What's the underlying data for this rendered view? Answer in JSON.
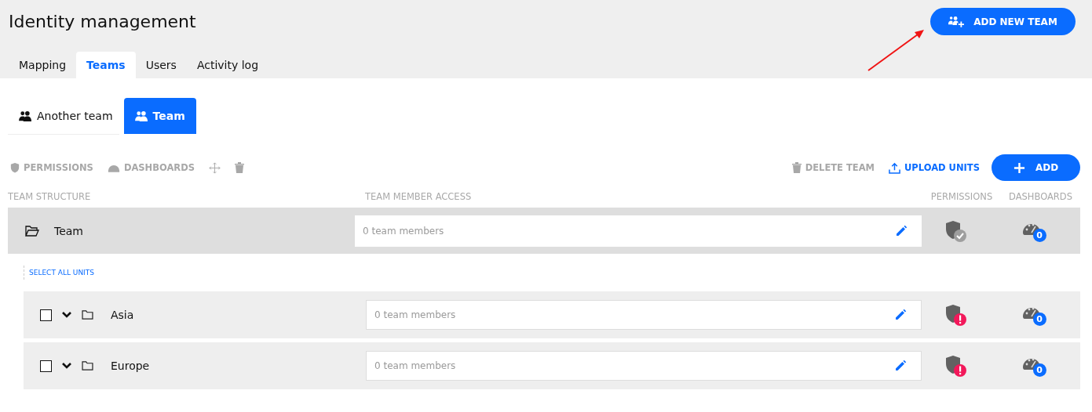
{
  "page": {
    "title": "Identity management"
  },
  "header_button": {
    "label": "ADD NEW TEAM"
  },
  "tabs": [
    {
      "label": "Mapping",
      "selected": false
    },
    {
      "label": "Teams",
      "selected": true
    },
    {
      "label": "Users",
      "selected": false
    },
    {
      "label": "Activity log",
      "selected": false
    }
  ],
  "team_tabs": [
    {
      "label": "Another team",
      "selected": false
    },
    {
      "label": "Team",
      "selected": true
    }
  ],
  "toolbar": {
    "left_actions": [
      {
        "kind": "permissions",
        "label": "PERMISSIONS",
        "disabled": true
      },
      {
        "kind": "dashboards",
        "label": "DASHBOARDS",
        "disabled": true
      },
      {
        "kind": "move",
        "disabled": true
      },
      {
        "kind": "delete",
        "disabled": true
      }
    ],
    "right_actions": [
      {
        "kind": "delete",
        "label": "DELETE TEAM",
        "disabled": true
      },
      {
        "kind": "upload",
        "label": "UPLOAD UNITS",
        "disabled": false
      }
    ],
    "add_button": {
      "label": "ADD"
    }
  },
  "columns": [
    "TEAM STRUCTURE",
    "TEAM MEMBER ACCESS",
    "PERMISSIONS",
    "DASHBOARDS"
  ],
  "root": {
    "name": "Team",
    "members": "0 team members",
    "permissions_ok": true,
    "dashboards_count": "0"
  },
  "select_all": "SELECT ALL UNITS",
  "units": [
    {
      "name": "Asia",
      "checked": false,
      "expanded": true,
      "members": "0 team members",
      "permissions_ok": false,
      "dashboards_count": "0"
    },
    {
      "name": "Europe",
      "checked": false,
      "expanded": true,
      "members": "0 team members",
      "permissions_ok": false,
      "dashboards_count": "0"
    }
  ]
}
